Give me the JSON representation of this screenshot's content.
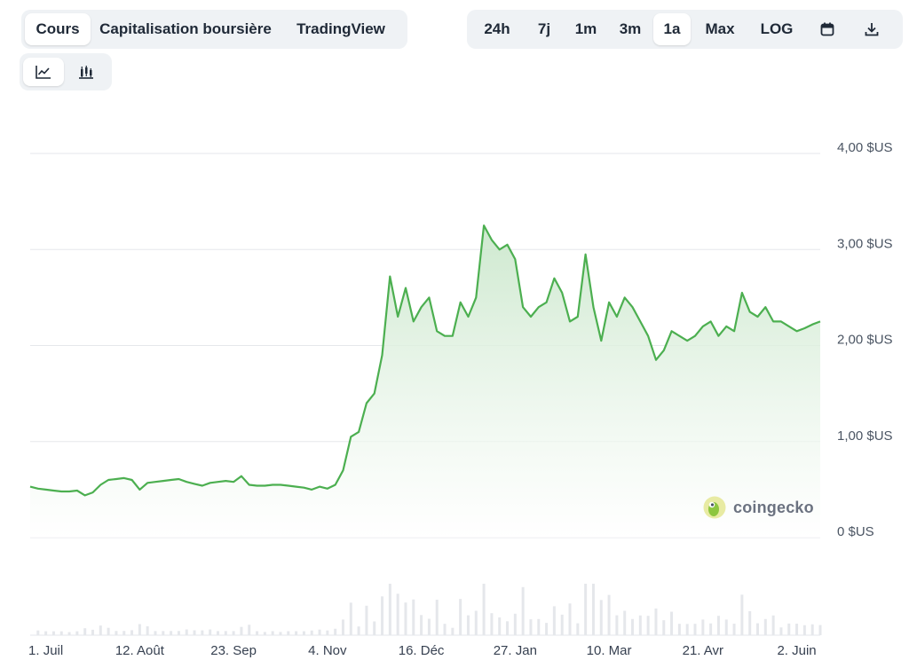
{
  "tabs": [
    {
      "label": "Cours",
      "active": true
    },
    {
      "label": "Capitalisation boursière",
      "active": false
    },
    {
      "label": "TradingView",
      "active": false
    }
  ],
  "ranges": [
    {
      "label": "24h",
      "active": false
    },
    {
      "label": "7j",
      "active": false
    },
    {
      "label": "1m",
      "active": false
    },
    {
      "label": "3m",
      "active": false
    },
    {
      "label": "1a",
      "active": true
    },
    {
      "label": "Max",
      "active": false
    },
    {
      "label": "LOG",
      "active": false
    }
  ],
  "icons": {
    "calendar": "calendar-icon",
    "download": "download-icon",
    "line": "line-chart-icon",
    "candle": "candlestick-chart-icon"
  },
  "colors": {
    "line": "#4caf50",
    "fill_top": "#c8e6c9",
    "fill_bottom": "#ffffff",
    "grid": "#e5e7eb",
    "volume": "#e5e7eb"
  },
  "watermark": "coingecko",
  "chart_data": {
    "type": "area",
    "title": "",
    "xlabel": "",
    "ylabel": "",
    "ylim": [
      0,
      4
    ],
    "y_ticks": [
      "4,00 $US",
      "3,00 $US",
      "2,00 $US",
      "1,00 $US",
      "0 $US"
    ],
    "y_tick_values": [
      4,
      3,
      2,
      1,
      0
    ],
    "x_ticks": [
      "1. Juil",
      "12. Août",
      "23. Sep",
      "4. Nov",
      "16. Déc",
      "27. Jan",
      "10. Mar",
      "21. Avr",
      "2. Juin"
    ],
    "x_tick_positions": [
      2,
      14,
      26,
      38,
      50,
      62,
      74,
      86,
      98
    ],
    "grid": true,
    "series": [
      {
        "x": [
          0,
          1,
          2,
          3,
          4,
          5,
          6,
          7,
          8,
          9,
          10,
          11,
          12,
          13,
          14,
          15,
          16,
          17,
          18,
          19,
          20,
          21,
          22,
          23,
          24,
          25,
          26,
          27,
          28,
          29,
          30,
          31,
          32,
          33,
          34,
          35,
          36,
          37,
          38,
          39,
          40,
          41,
          42,
          43,
          44,
          45,
          46,
          47,
          48,
          49,
          50,
          51,
          52,
          53,
          54,
          55,
          56,
          57,
          58,
          59,
          60,
          61,
          62,
          63,
          64,
          65,
          66,
          67,
          68,
          69,
          70,
          71,
          72,
          73,
          74,
          75,
          76,
          77,
          78,
          79,
          80,
          81,
          82,
          83,
          84,
          85,
          86,
          87,
          88,
          89,
          90,
          91,
          92,
          93,
          94,
          95,
          96,
          97,
          98,
          99,
          100,
          101
        ],
        "values": [
          0.53,
          0.51,
          0.5,
          0.49,
          0.48,
          0.48,
          0.49,
          0.44,
          0.47,
          0.55,
          0.6,
          0.61,
          0.62,
          0.6,
          0.5,
          0.57,
          0.58,
          0.59,
          0.6,
          0.61,
          0.58,
          0.56,
          0.54,
          0.57,
          0.58,
          0.59,
          0.58,
          0.64,
          0.55,
          0.54,
          0.54,
          0.55,
          0.55,
          0.54,
          0.53,
          0.52,
          0.5,
          0.53,
          0.51,
          0.55,
          0.7,
          1.05,
          1.1,
          1.4,
          1.5,
          1.9,
          2.72,
          2.3,
          2.6,
          2.25,
          2.4,
          2.5,
          2.15,
          2.1,
          2.1,
          2.45,
          2.3,
          2.5,
          3.25,
          3.1,
          3.0,
          3.05,
          2.9,
          2.4,
          2.3,
          2.4,
          2.45,
          2.7,
          2.55,
          2.25,
          2.3,
          2.95,
          2.4,
          2.05,
          2.45,
          2.3,
          2.5,
          2.4,
          2.25,
          2.1,
          1.85,
          1.95,
          2.15,
          2.1,
          2.05,
          2.1,
          2.2,
          2.25,
          2.1,
          2.2,
          2.15,
          2.55,
          2.35,
          2.3,
          2.4,
          2.25,
          2.25,
          2.2,
          2.15,
          2.18,
          2.22,
          2.25
        ]
      }
    ]
  }
}
